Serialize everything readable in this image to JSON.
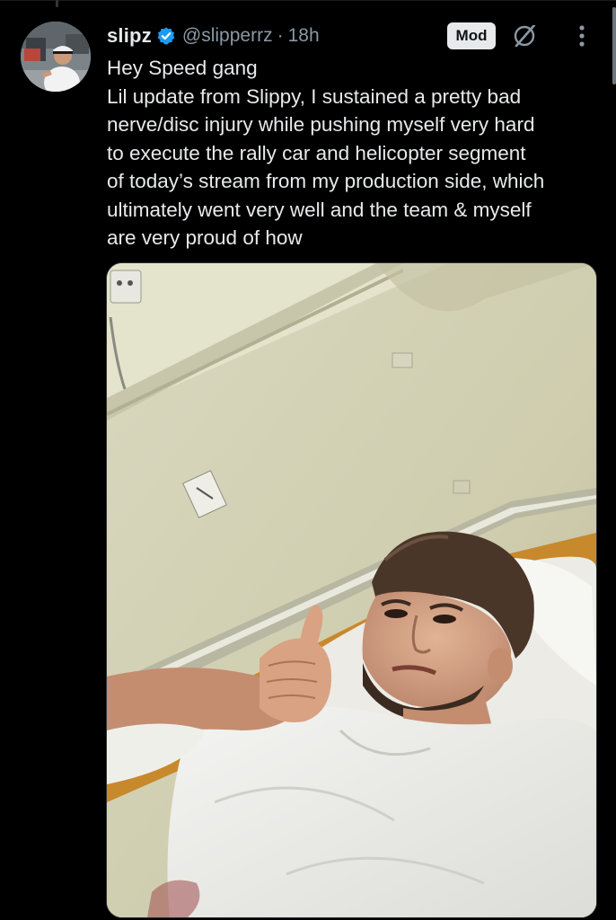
{
  "tweet": {
    "author": {
      "display_name": "slipz",
      "handle": "@slipperrz",
      "verified": true,
      "avatar_icon": "profile-photo"
    },
    "separator": "·",
    "timestamp": "18h",
    "badge": "Mod",
    "actions": {
      "grok_icon": "grok-icon",
      "more_icon": "more-vertical-icon"
    },
    "text_lines": [
      "Hey Speed gang",
      "Lil update from Slippy, I sustained a pretty bad",
      "nerve/disc injury while pushing myself very hard",
      "to execute the rally car and helicopter segment",
      "of today’s stream from my production side, which",
      "ultimately went very well and the team & myself",
      "are very proud of how"
    ],
    "media": {
      "type": "photo"
    }
  },
  "colors": {
    "background": "#000000",
    "text_primary": "#e7e9ea",
    "text_secondary": "#8b98a5",
    "verified_blue": "#1d9bf0",
    "badge_bg": "#e7e9ea"
  }
}
